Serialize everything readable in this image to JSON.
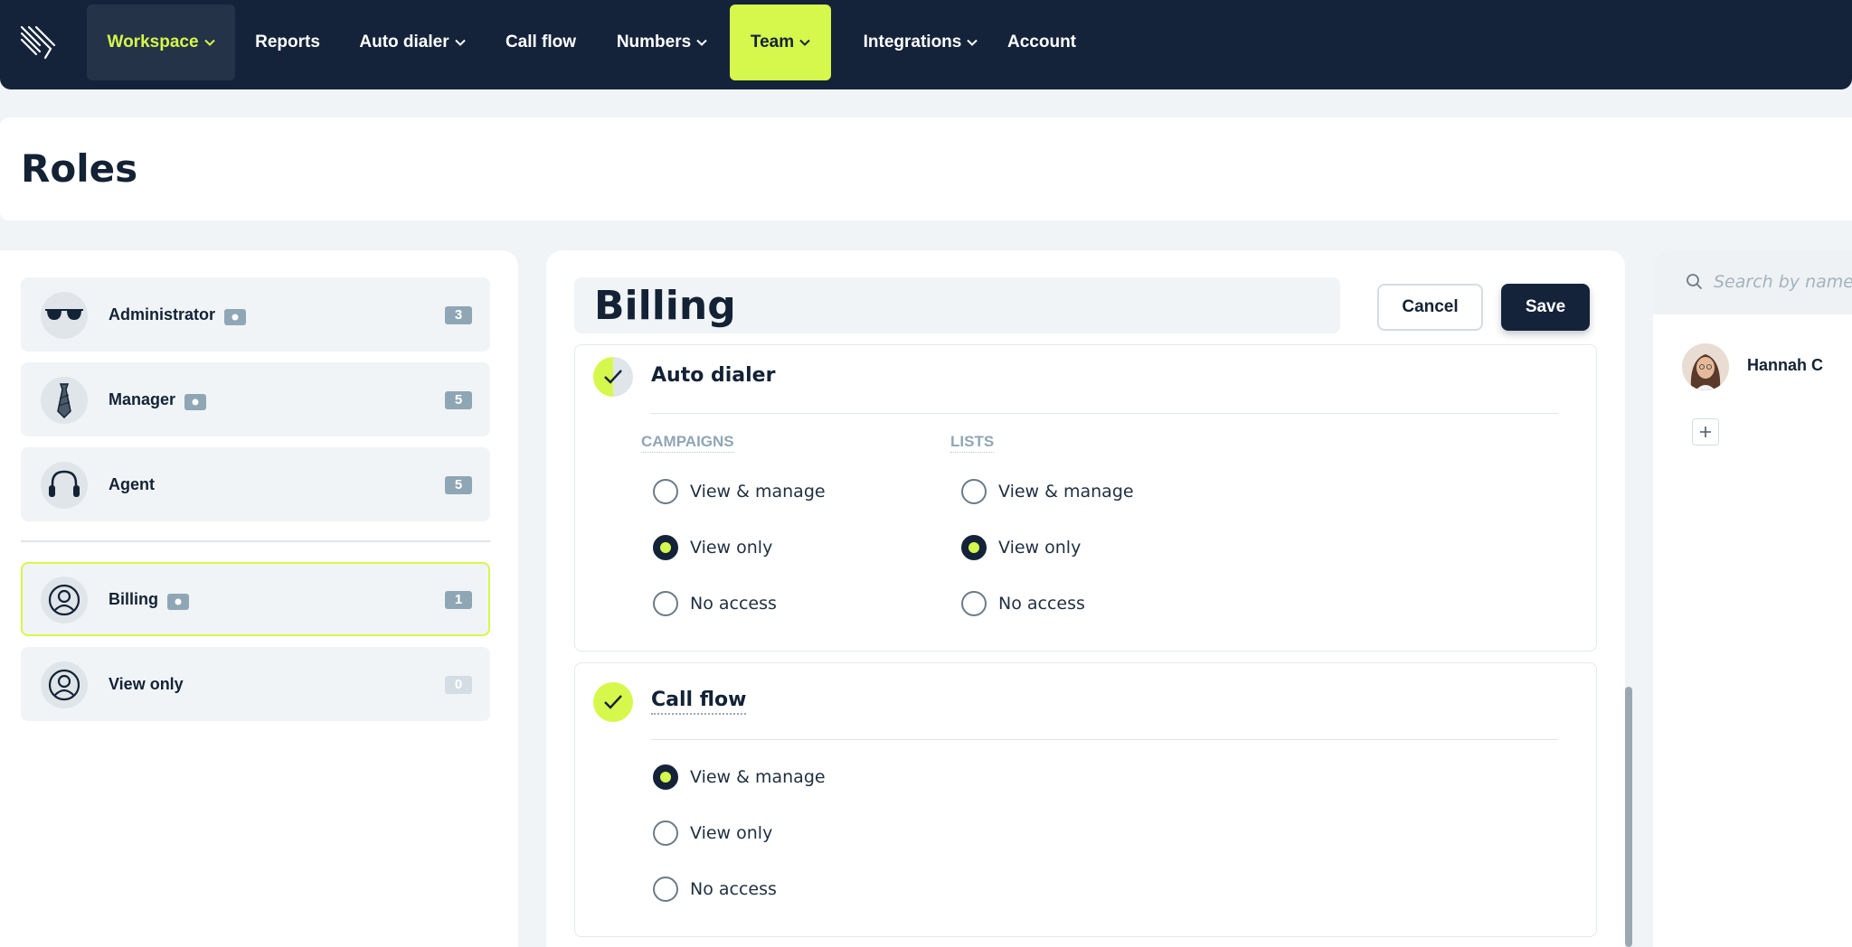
{
  "nav": {
    "items": [
      {
        "label": "Workspace",
        "has_chevron": true,
        "state": "workspace"
      },
      {
        "label": "Reports",
        "has_chevron": false
      },
      {
        "label": "Auto dialer",
        "has_chevron": true
      },
      {
        "label": "Call flow",
        "has_chevron": false
      },
      {
        "label": "Numbers",
        "has_chevron": true
      },
      {
        "label": "Team",
        "has_chevron": true,
        "state": "active"
      },
      {
        "label": "Integrations",
        "has_chevron": true
      },
      {
        "label": "Account",
        "has_chevron": false
      }
    ]
  },
  "page": {
    "title": "Roles"
  },
  "roles": [
    {
      "name": "Administrator",
      "icon": "sunglasses-icon",
      "count": "3",
      "has_eye": true
    },
    {
      "name": "Manager",
      "icon": "necktie-icon",
      "count": "5",
      "has_eye": true
    },
    {
      "name": "Agent",
      "icon": "headset-icon",
      "count": "5",
      "has_eye": false
    },
    {
      "name": "Billing",
      "icon": "user-circle-icon",
      "count": "1",
      "has_eye": true,
      "selected": true
    },
    {
      "name": "View only",
      "icon": "user-circle-icon",
      "count": "0",
      "has_eye": false
    }
  ],
  "editor": {
    "role_name": "Billing",
    "cancel_label": "Cancel",
    "save_label": "Save",
    "sections": [
      {
        "title": "Auto dialer",
        "groups": [
          {
            "heading": "CAMPAIGNS",
            "options": [
              "View & manage",
              "View only",
              "No access"
            ],
            "selected": "View only"
          },
          {
            "heading": "LISTS",
            "options": [
              "View & manage",
              "View only",
              "No access"
            ],
            "selected": "View only"
          }
        ]
      },
      {
        "title": "Call flow",
        "groups": [
          {
            "heading": "",
            "options": [
              "View & manage",
              "View only",
              "No access"
            ],
            "selected": "View & manage"
          }
        ]
      }
    ]
  },
  "members": {
    "search_placeholder": "Search by name",
    "list": [
      {
        "name": "Hannah C"
      }
    ]
  },
  "colors": {
    "navy": "#14233a",
    "accent": "#d6f84c",
    "panel_bg": "#f0f4f6",
    "muted": "#8fa6b5"
  }
}
